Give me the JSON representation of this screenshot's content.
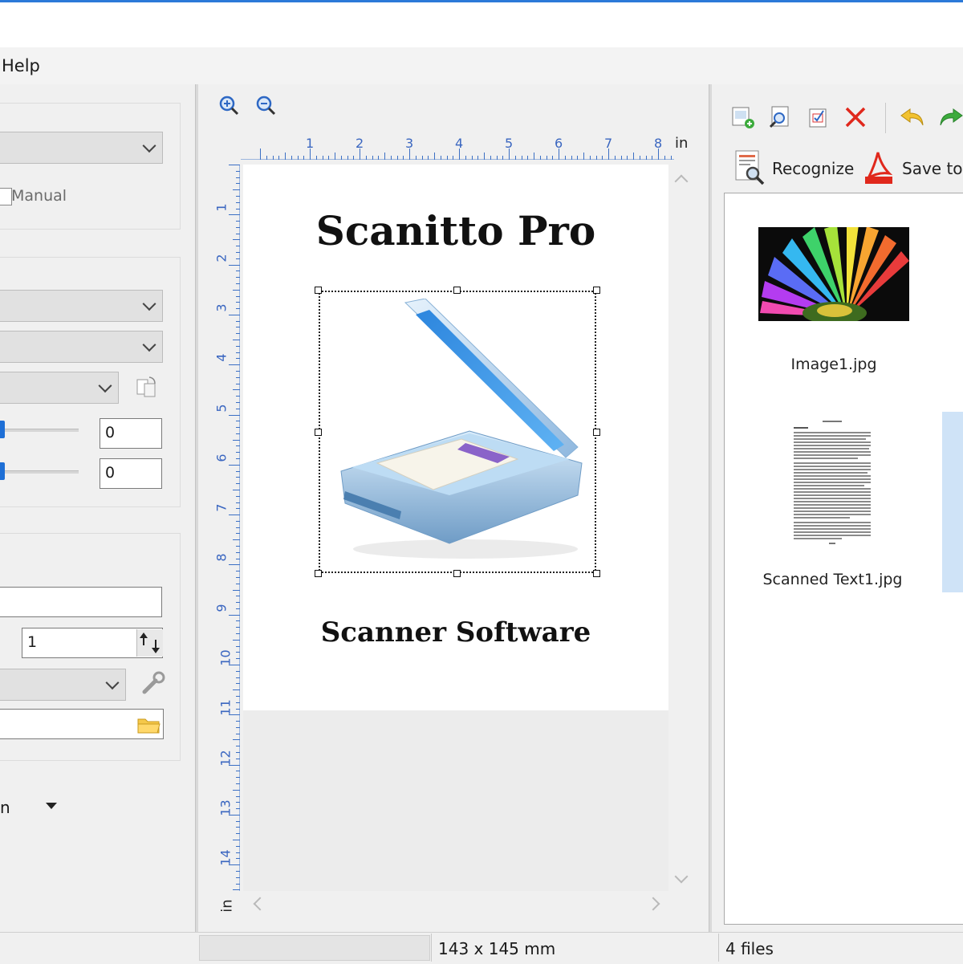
{
  "menu": {
    "help_label": "Help"
  },
  "left_panel": {
    "manual_label": "Manual",
    "spin1_value": "0",
    "spin2_value": "0",
    "count_value": "1",
    "dropdown_partial_label": "n"
  },
  "preview": {
    "ruler_unit": "in",
    "ruler_h_numbers": [
      "1",
      "2",
      "3",
      "4",
      "5",
      "6",
      "7",
      "8"
    ],
    "ruler_v_numbers": [
      "1",
      "2",
      "3",
      "4",
      "5",
      "6",
      "7",
      "8",
      "9",
      "10",
      "11",
      "12",
      "13",
      "14"
    ],
    "document_title": "Scanitto Pro",
    "document_subtitle": "Scanner Software"
  },
  "toolbar_right": {
    "recognize_label": "Recognize",
    "save_label": "Save to"
  },
  "files": [
    {
      "name": "Image1.jpg"
    },
    {
      "name": "Scanned Text1.jpg"
    }
  ],
  "status": {
    "size_text": "143 x 145 mm",
    "files_count": "4 files"
  },
  "colors": {
    "accent": "#2b79d8",
    "ruler": "#3b6fc4",
    "selection_highlight": "#cfe3f7"
  }
}
